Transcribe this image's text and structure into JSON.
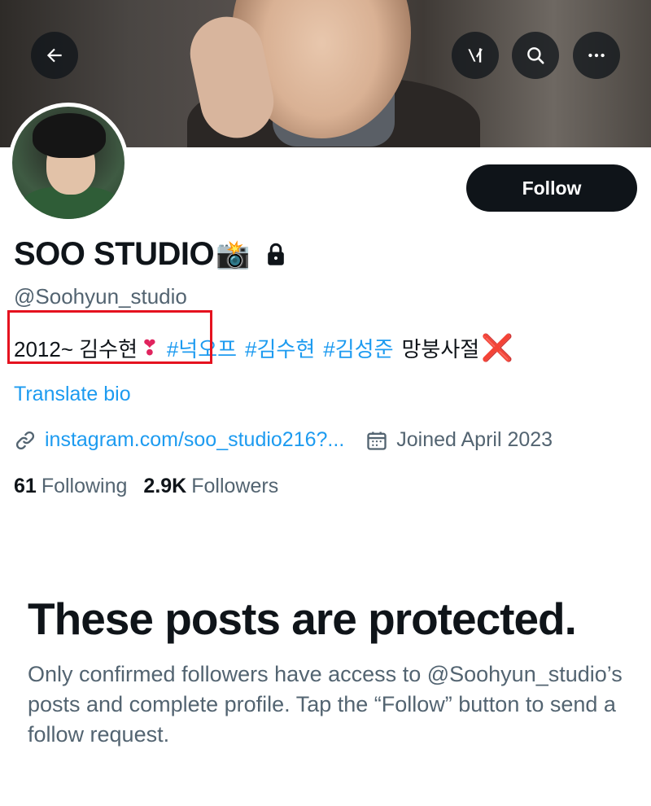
{
  "header": {
    "back_icon": "arrow-left-icon",
    "grok_icon": "grok-icon",
    "search_icon": "search-icon",
    "more_icon": "more-horizontal-icon"
  },
  "profile": {
    "display_name": "SOO STUDIO",
    "name_emoji": "📸",
    "protected_icon": "lock-icon",
    "handle": "@Soohyun_studio",
    "follow_label": "Follow",
    "bio": {
      "prefix": "2012~ 김수현",
      "heart": "❣",
      "hashtags": [
        "#넉오프",
        "#김수현",
        "#김성준"
      ],
      "suffix": "망붕사절",
      "suffix_mark": "❌"
    },
    "translate_label": "Translate bio",
    "link_text": "instagram.com/soo_studio216?...",
    "joined_text": "Joined April 2023",
    "following_count": "61",
    "following_label": "Following",
    "followers_count": "2.9K",
    "followers_label": "Followers"
  },
  "protected": {
    "title": "These posts are protected.",
    "body": "Only confirmed followers have access to @Soohyun_studio’s posts and complete profile. Tap the “Follow” button to send a follow request."
  },
  "colors": {
    "accent": "#1d9bf0",
    "text": "#0f1419",
    "secondary": "#536471",
    "highlight_box": "#e5121f"
  }
}
